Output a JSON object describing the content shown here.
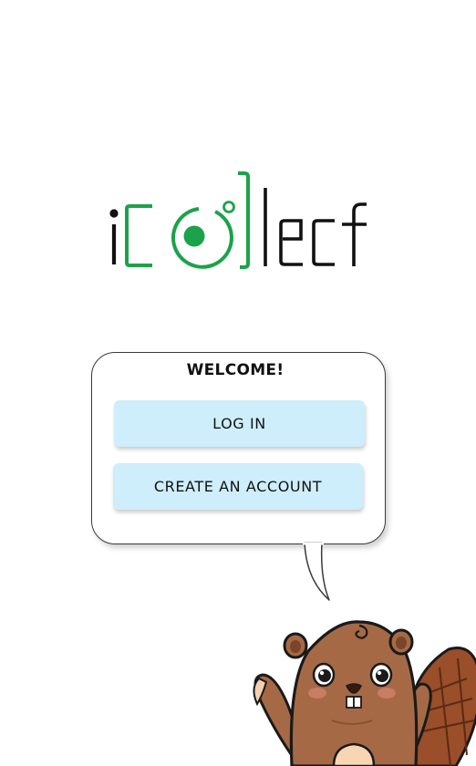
{
  "logo": {
    "text": "iCollect",
    "accent_color": "#1aa34a",
    "ink_color": "#111111"
  },
  "welcome": {
    "title": "WELCOME!"
  },
  "actions": {
    "login_label": "LOG IN",
    "create_account_label": "CREATE AN ACCOUNT"
  },
  "theme": {
    "button_bg": "#cdeefa",
    "bubble_border": "#3a3a3a"
  },
  "mascot": {
    "icon": "beaver-mascot-icon"
  }
}
